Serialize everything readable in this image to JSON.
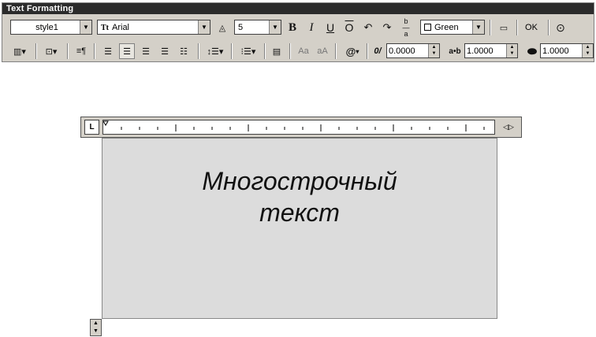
{
  "window": {
    "title": "Text Formatting"
  },
  "toolbar": {
    "style": "style1",
    "font": "Arial",
    "font_prefix": "Tt",
    "height": "5",
    "color": "Green",
    "ok_label": "OK",
    "obliquing": "0.0000",
    "tracking": "1.0000",
    "width_factor": "1.0000",
    "bold_glyph": "B",
    "italic_glyph": "I",
    "underline_glyph": "U",
    "overline_glyph": "O",
    "case_upper": "Aa",
    "case_lower": "aA",
    "symbol_glyph": "@",
    "oblique_glyph": "0/",
    "tracking_glyph": "a•b"
  },
  "ruler": {
    "tab_selector": "L"
  },
  "editor": {
    "lines": [
      "Многострочный",
      "текст"
    ]
  }
}
